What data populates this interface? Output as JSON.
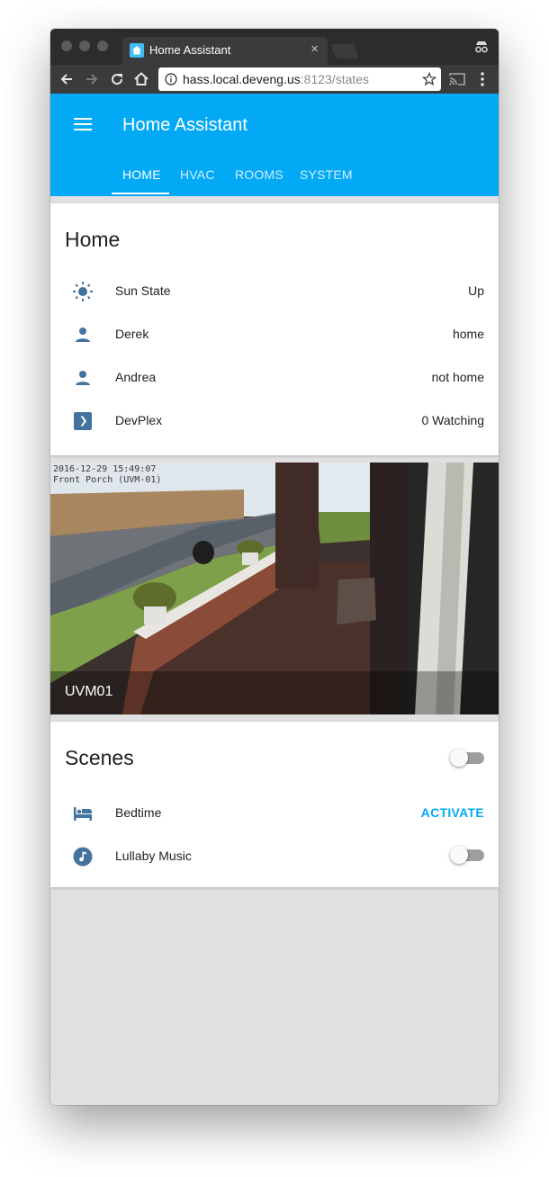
{
  "browser": {
    "tab_title": "Home Assistant",
    "tab_close": "×",
    "url_host": "hass.local.deveng.us",
    "url_rest": ":8123/states"
  },
  "app": {
    "title": "Home Assistant",
    "accent_color": "#03a9f4",
    "tabs": [
      {
        "label": "HOME",
        "active": true
      },
      {
        "label": "HVAC",
        "active": false
      },
      {
        "label": "ROOMS",
        "active": false
      },
      {
        "label": "SYSTEM",
        "active": false
      }
    ]
  },
  "home_card": {
    "title": "Home",
    "rows": [
      {
        "icon": "sun-icon",
        "name": "Sun State",
        "state": "Up"
      },
      {
        "icon": "person-icon",
        "name": "Derek",
        "state": "home"
      },
      {
        "icon": "person-icon",
        "name": "Andrea",
        "state": "not home"
      },
      {
        "icon": "plex-icon",
        "name": "DevPlex",
        "state": "0 Watching"
      }
    ]
  },
  "camera": {
    "name": "UVM01",
    "overlay_line1": "2016-12-29 15:49:07",
    "overlay_line2": "Front Porch (UVM-01)"
  },
  "scenes_card": {
    "title": "Scenes",
    "group_toggle_on": false,
    "rows": [
      {
        "icon": "bed-icon",
        "name": "Bedtime",
        "action": "ACTIVATE"
      },
      {
        "icon": "music-note-icon",
        "name": "Lullaby Music",
        "toggle_on": false
      }
    ]
  }
}
